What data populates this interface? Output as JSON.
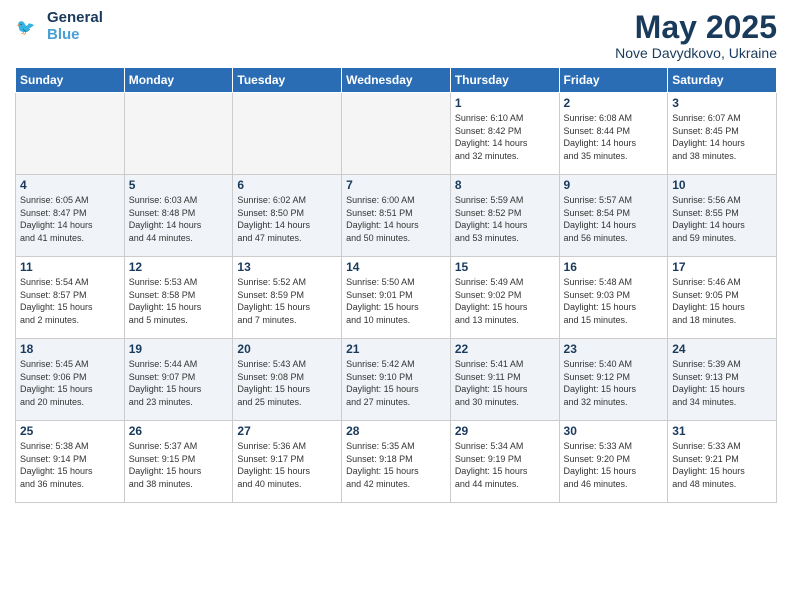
{
  "header": {
    "logo_line1": "General",
    "logo_line2": "Blue",
    "month_title": "May 2025",
    "subtitle": "Nove Davydkovo, Ukraine"
  },
  "weekdays": [
    "Sunday",
    "Monday",
    "Tuesday",
    "Wednesday",
    "Thursday",
    "Friday",
    "Saturday"
  ],
  "weeks": [
    [
      {
        "day": "",
        "info": "",
        "empty": true
      },
      {
        "day": "",
        "info": "",
        "empty": true
      },
      {
        "day": "",
        "info": "",
        "empty": true
      },
      {
        "day": "",
        "info": "",
        "empty": true
      },
      {
        "day": "1",
        "info": "Sunrise: 6:10 AM\nSunset: 8:42 PM\nDaylight: 14 hours\nand 32 minutes."
      },
      {
        "day": "2",
        "info": "Sunrise: 6:08 AM\nSunset: 8:44 PM\nDaylight: 14 hours\nand 35 minutes."
      },
      {
        "day": "3",
        "info": "Sunrise: 6:07 AM\nSunset: 8:45 PM\nDaylight: 14 hours\nand 38 minutes."
      }
    ],
    [
      {
        "day": "4",
        "info": "Sunrise: 6:05 AM\nSunset: 8:47 PM\nDaylight: 14 hours\nand 41 minutes."
      },
      {
        "day": "5",
        "info": "Sunrise: 6:03 AM\nSunset: 8:48 PM\nDaylight: 14 hours\nand 44 minutes."
      },
      {
        "day": "6",
        "info": "Sunrise: 6:02 AM\nSunset: 8:50 PM\nDaylight: 14 hours\nand 47 minutes."
      },
      {
        "day": "7",
        "info": "Sunrise: 6:00 AM\nSunset: 8:51 PM\nDaylight: 14 hours\nand 50 minutes."
      },
      {
        "day": "8",
        "info": "Sunrise: 5:59 AM\nSunset: 8:52 PM\nDaylight: 14 hours\nand 53 minutes."
      },
      {
        "day": "9",
        "info": "Sunrise: 5:57 AM\nSunset: 8:54 PM\nDaylight: 14 hours\nand 56 minutes."
      },
      {
        "day": "10",
        "info": "Sunrise: 5:56 AM\nSunset: 8:55 PM\nDaylight: 14 hours\nand 59 minutes."
      }
    ],
    [
      {
        "day": "11",
        "info": "Sunrise: 5:54 AM\nSunset: 8:57 PM\nDaylight: 15 hours\nand 2 minutes."
      },
      {
        "day": "12",
        "info": "Sunrise: 5:53 AM\nSunset: 8:58 PM\nDaylight: 15 hours\nand 5 minutes."
      },
      {
        "day": "13",
        "info": "Sunrise: 5:52 AM\nSunset: 8:59 PM\nDaylight: 15 hours\nand 7 minutes."
      },
      {
        "day": "14",
        "info": "Sunrise: 5:50 AM\nSunset: 9:01 PM\nDaylight: 15 hours\nand 10 minutes."
      },
      {
        "day": "15",
        "info": "Sunrise: 5:49 AM\nSunset: 9:02 PM\nDaylight: 15 hours\nand 13 minutes."
      },
      {
        "day": "16",
        "info": "Sunrise: 5:48 AM\nSunset: 9:03 PM\nDaylight: 15 hours\nand 15 minutes."
      },
      {
        "day": "17",
        "info": "Sunrise: 5:46 AM\nSunset: 9:05 PM\nDaylight: 15 hours\nand 18 minutes."
      }
    ],
    [
      {
        "day": "18",
        "info": "Sunrise: 5:45 AM\nSunset: 9:06 PM\nDaylight: 15 hours\nand 20 minutes."
      },
      {
        "day": "19",
        "info": "Sunrise: 5:44 AM\nSunset: 9:07 PM\nDaylight: 15 hours\nand 23 minutes."
      },
      {
        "day": "20",
        "info": "Sunrise: 5:43 AM\nSunset: 9:08 PM\nDaylight: 15 hours\nand 25 minutes."
      },
      {
        "day": "21",
        "info": "Sunrise: 5:42 AM\nSunset: 9:10 PM\nDaylight: 15 hours\nand 27 minutes."
      },
      {
        "day": "22",
        "info": "Sunrise: 5:41 AM\nSunset: 9:11 PM\nDaylight: 15 hours\nand 30 minutes."
      },
      {
        "day": "23",
        "info": "Sunrise: 5:40 AM\nSunset: 9:12 PM\nDaylight: 15 hours\nand 32 minutes."
      },
      {
        "day": "24",
        "info": "Sunrise: 5:39 AM\nSunset: 9:13 PM\nDaylight: 15 hours\nand 34 minutes."
      }
    ],
    [
      {
        "day": "25",
        "info": "Sunrise: 5:38 AM\nSunset: 9:14 PM\nDaylight: 15 hours\nand 36 minutes."
      },
      {
        "day": "26",
        "info": "Sunrise: 5:37 AM\nSunset: 9:15 PM\nDaylight: 15 hours\nand 38 minutes."
      },
      {
        "day": "27",
        "info": "Sunrise: 5:36 AM\nSunset: 9:17 PM\nDaylight: 15 hours\nand 40 minutes."
      },
      {
        "day": "28",
        "info": "Sunrise: 5:35 AM\nSunset: 9:18 PM\nDaylight: 15 hours\nand 42 minutes."
      },
      {
        "day": "29",
        "info": "Sunrise: 5:34 AM\nSunset: 9:19 PM\nDaylight: 15 hours\nand 44 minutes."
      },
      {
        "day": "30",
        "info": "Sunrise: 5:33 AM\nSunset: 9:20 PM\nDaylight: 15 hours\nand 46 minutes."
      },
      {
        "day": "31",
        "info": "Sunrise: 5:33 AM\nSunset: 9:21 PM\nDaylight: 15 hours\nand 48 minutes."
      }
    ]
  ],
  "colors": {
    "header_bg": "#2a6db5",
    "title_color": "#1a3a5c",
    "alt_row": "#f0f4f8"
  }
}
